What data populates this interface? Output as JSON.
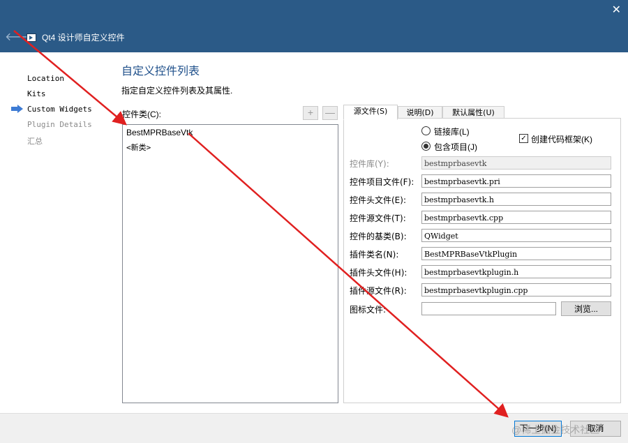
{
  "window": {
    "title": "Qt4 设计师自定义控件",
    "close_icon": "✕",
    "back_icon": "🡐"
  },
  "steps": [
    {
      "label": "Location",
      "state": "done"
    },
    {
      "label": "Kits",
      "state": "done"
    },
    {
      "label": "Custom Widgets",
      "state": "current"
    },
    {
      "label": "Plugin Details",
      "state": "pending"
    },
    {
      "label": "汇总",
      "state": "pending"
    }
  ],
  "page": {
    "title": "自定义控件列表",
    "subtitle": "指定自定义控件列表及其属性."
  },
  "widget_list": {
    "label": "控件类(C):",
    "add_label": "+",
    "remove_label": "—",
    "items": [
      "BestMPRBaseVtk",
      "<新类>"
    ]
  },
  "tabs": [
    {
      "label": "源文件(S)",
      "active": true
    },
    {
      "label": "说明(D)",
      "active": false
    },
    {
      "label": "默认属性(U)",
      "active": false
    }
  ],
  "options": {
    "link_library": "链接库(L)",
    "include_project": "包含项目(J)",
    "selected": "include_project",
    "create_skeleton": "创建代码框架(K)",
    "create_skeleton_checked": true
  },
  "fields": {
    "library": {
      "label": "控件库(Y):",
      "value": "bestmprbasevtk"
    },
    "project_file": {
      "label": "控件项目文件(F):",
      "value": "bestmprbasevtk.pri"
    },
    "header_file": {
      "label": "控件头文件(E):",
      "value": "bestmprbasevtk.h"
    },
    "source_file": {
      "label": "控件源文件(T):",
      "value": "bestmprbasevtk.cpp"
    },
    "base_class": {
      "label": "控件的基类(B):",
      "value": "QWidget"
    },
    "plugin_class": {
      "label": "插件类名(N):",
      "value": "BestMPRBaseVtkPlugin"
    },
    "plugin_header": {
      "label": "插件头文件(H):",
      "value": "bestmprbasevtkplugin.h"
    },
    "plugin_source": {
      "label": "插件源文件(R):",
      "value": "bestmprbasevtkplugin.cpp"
    },
    "icon_file": {
      "label": "图标文件:",
      "value": ""
    }
  },
  "browse_label": "浏览...",
  "footer": {
    "next_label": "下一步(N)",
    "cancel_label": "取消",
    "watermark": "@稀土掘金技术社区"
  },
  "colors": {
    "titlebar": "#2b5a87",
    "annotation": "#e02020",
    "title_text": "#1e4f8a"
  }
}
